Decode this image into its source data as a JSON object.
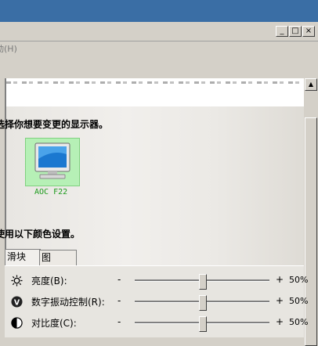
{
  "window": {
    "controls": [
      "_",
      "□",
      "×"
    ]
  },
  "menubar": {
    "partial_item": "动(H)"
  },
  "section1": {
    "heading": "选择你想要变更的显示器。"
  },
  "monitor": {
    "label": "AOC F22"
  },
  "section2": {
    "heading": "使用以下颜色设置。"
  },
  "tabs": [
    {
      "label": "滑块"
    },
    {
      "label": "图"
    }
  ],
  "sliders": [
    {
      "icon": "brightness-icon",
      "label": "亮度(B):",
      "minus": "-",
      "plus": "+",
      "value_text": "50%",
      "value": 0.5
    },
    {
      "icon": "digital-vibrance-icon",
      "label": "数字振动控制(R):",
      "minus": "-",
      "plus": "+",
      "value_text": "50%",
      "value": 0.5
    },
    {
      "icon": "contrast-icon",
      "label": "对比度(C):",
      "minus": "-",
      "plus": "+",
      "value_text": "50%",
      "value": 0.5
    }
  ]
}
